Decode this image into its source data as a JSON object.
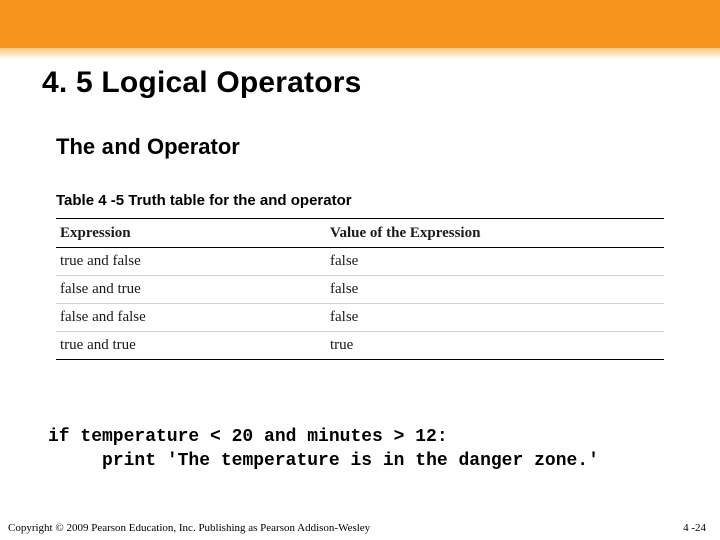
{
  "title": "4. 5 Logical Operators",
  "subtitle_prefix": "The ",
  "subtitle_code": "and",
  "subtitle_suffix": " Operator",
  "table_caption": "Table 4 -5  Truth table for the and operator",
  "table": {
    "headers": [
      "Expression",
      "Value of the Expression"
    ],
    "rows": [
      [
        "true and false",
        "false"
      ],
      [
        "false and true",
        "false"
      ],
      [
        "false and false",
        "false"
      ],
      [
        "true and true",
        "true"
      ]
    ]
  },
  "code": "if temperature < 20 and minutes > 12:\n     print 'The temperature is in the danger zone.'",
  "copyright": "Copyright © 2009 Pearson Education, Inc. Publishing as Pearson Addison-Wesley",
  "slide_number": "4 -24"
}
